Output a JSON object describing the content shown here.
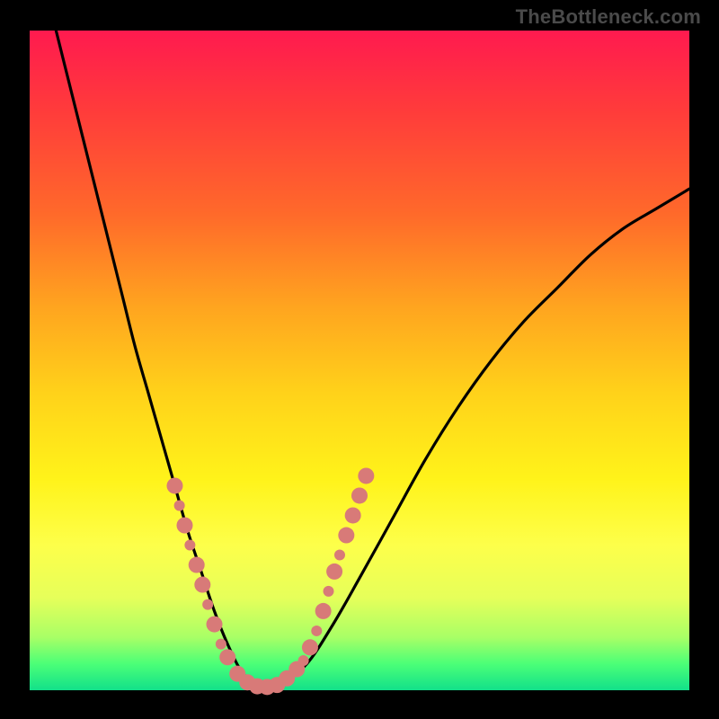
{
  "watermark": "TheBottleneck.com",
  "chart_data": {
    "type": "line",
    "title": "",
    "xlabel": "",
    "ylabel": "",
    "xlim": [
      0,
      100
    ],
    "ylim": [
      0,
      100
    ],
    "curve": {
      "name": "bottleneck-curve",
      "x": [
        4,
        6,
        8,
        10,
        12,
        14,
        16,
        18,
        20,
        22,
        24,
        26,
        28,
        30,
        32,
        34,
        36,
        38,
        42,
        46,
        50,
        55,
        60,
        65,
        70,
        75,
        80,
        85,
        90,
        95,
        100
      ],
      "y": [
        100,
        92,
        84,
        76,
        68,
        60,
        52,
        45,
        38,
        31,
        24,
        18,
        12,
        7,
        3,
        1,
        0.5,
        1,
        4,
        10,
        17,
        26,
        35,
        43,
        50,
        56,
        61,
        66,
        70,
        73,
        76
      ]
    },
    "markers": {
      "name": "sample-points",
      "color": "#d87a78",
      "radius_primary": 9,
      "radius_secondary": 6,
      "points": [
        {
          "x": 22,
          "y": 31,
          "r": "primary"
        },
        {
          "x": 22.7,
          "y": 28,
          "r": "secondary"
        },
        {
          "x": 23.5,
          "y": 25,
          "r": "primary"
        },
        {
          "x": 24.3,
          "y": 22,
          "r": "secondary"
        },
        {
          "x": 25.3,
          "y": 19,
          "r": "primary"
        },
        {
          "x": 26.2,
          "y": 16,
          "r": "primary"
        },
        {
          "x": 27.0,
          "y": 13,
          "r": "secondary"
        },
        {
          "x": 28.0,
          "y": 10,
          "r": "primary"
        },
        {
          "x": 29.0,
          "y": 7,
          "r": "secondary"
        },
        {
          "x": 30.0,
          "y": 5,
          "r": "primary"
        },
        {
          "x": 31.5,
          "y": 2.5,
          "r": "primary"
        },
        {
          "x": 33.0,
          "y": 1.2,
          "r": "primary"
        },
        {
          "x": 34.5,
          "y": 0.6,
          "r": "primary"
        },
        {
          "x": 36.0,
          "y": 0.5,
          "r": "primary"
        },
        {
          "x": 37.5,
          "y": 0.8,
          "r": "primary"
        },
        {
          "x": 39.0,
          "y": 1.8,
          "r": "primary"
        },
        {
          "x": 40.5,
          "y": 3.2,
          "r": "primary"
        },
        {
          "x": 41.5,
          "y": 4.5,
          "r": "secondary"
        },
        {
          "x": 42.5,
          "y": 6.5,
          "r": "primary"
        },
        {
          "x": 43.5,
          "y": 9,
          "r": "secondary"
        },
        {
          "x": 44.5,
          "y": 12,
          "r": "primary"
        },
        {
          "x": 45.3,
          "y": 15,
          "r": "secondary"
        },
        {
          "x": 46.2,
          "y": 18,
          "r": "primary"
        },
        {
          "x": 47.0,
          "y": 20.5,
          "r": "secondary"
        },
        {
          "x": 48.0,
          "y": 23.5,
          "r": "primary"
        },
        {
          "x": 49.0,
          "y": 26.5,
          "r": "primary"
        },
        {
          "x": 50.0,
          "y": 29.5,
          "r": "primary"
        },
        {
          "x": 51.0,
          "y": 32.5,
          "r": "primary"
        }
      ]
    }
  }
}
